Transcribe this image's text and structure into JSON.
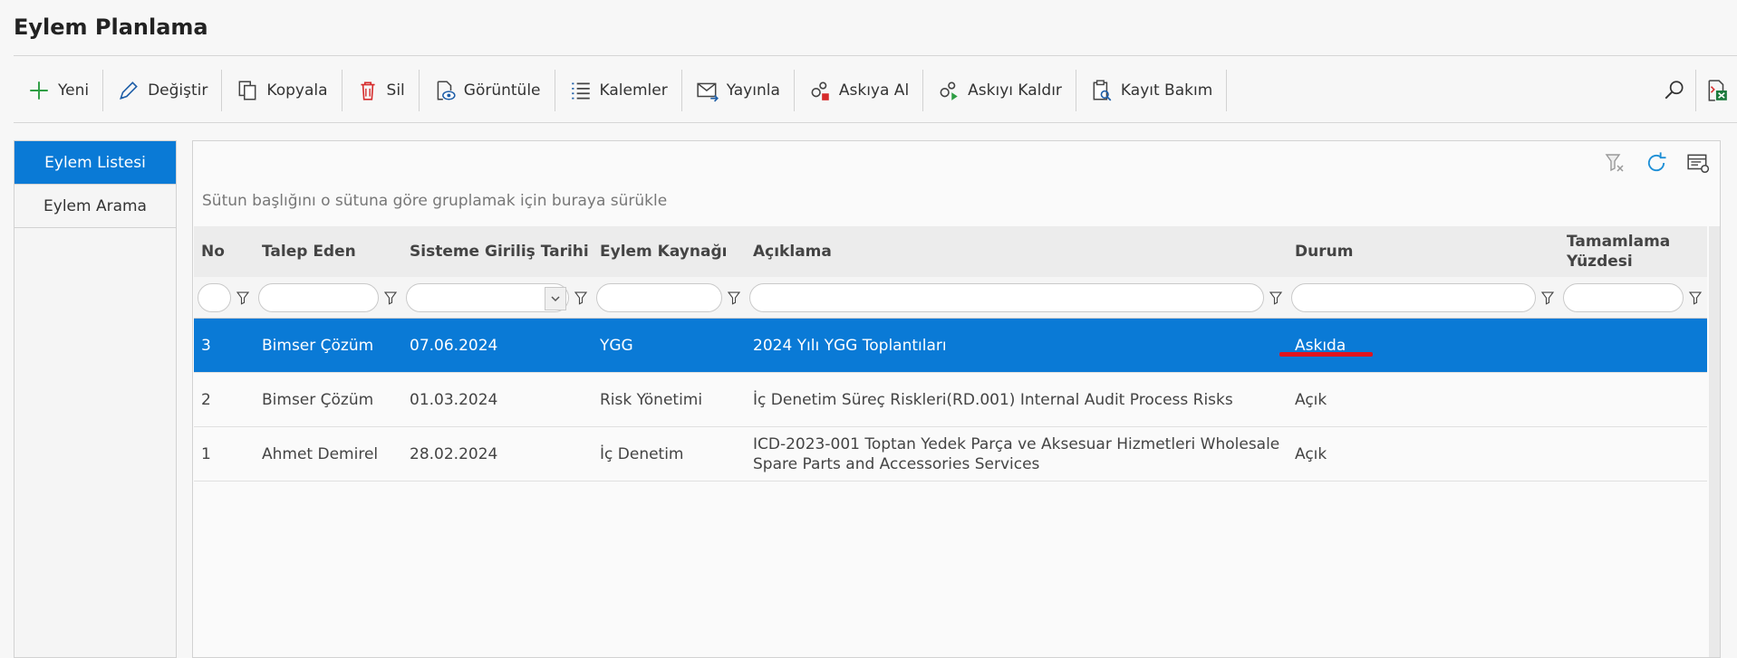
{
  "page": {
    "title": "Eylem Planlama"
  },
  "toolbar": {
    "items": [
      {
        "label": "Yeni",
        "icon": "plus-icon"
      },
      {
        "label": "Değiştir",
        "icon": "pencil-icon"
      },
      {
        "label": "Kopyala",
        "icon": "copy-icon"
      },
      {
        "label": "Sil",
        "icon": "trash-icon"
      },
      {
        "label": "Görüntüle",
        "icon": "eye-document-icon"
      },
      {
        "label": "Kalemler",
        "icon": "list-icon"
      },
      {
        "label": "Yayınla",
        "icon": "mail-send-icon"
      },
      {
        "label": "Askıya Al",
        "icon": "gears-stop-icon"
      },
      {
        "label": "Askıyı Kaldır",
        "icon": "gears-play-icon"
      },
      {
        "label": "Kayıt Bakım",
        "icon": "clipboard-search-icon"
      }
    ],
    "right_icons": [
      "search-icon",
      "excel-export-icon"
    ]
  },
  "sidebar": {
    "items": [
      {
        "label": "Eylem Listesi",
        "active": true
      },
      {
        "label": "Eylem Arama",
        "active": false
      }
    ]
  },
  "grid": {
    "group_hint": "Sütun başlığını o sütuna göre gruplamak için buraya sürükle",
    "columns": {
      "no": "No",
      "talep": "Talep Eden",
      "tarih": "Sisteme Giriliş Tarihi",
      "kaynak": "Eylem Kaynağı",
      "aciklama": "Açıklama",
      "durum": "Durum",
      "yuzde": "Tamamlama Yüzdesi"
    },
    "rows": [
      {
        "no": "3",
        "talep": "Bimser Çözüm",
        "tarih": "07.06.2024",
        "kaynak": "YGG",
        "aciklama": "2024 Yılı YGG Toplantıları",
        "durum": "Askıda",
        "yuzde": ""
      },
      {
        "no": "2",
        "talep": "Bimser Çözüm",
        "tarih": "01.03.2024",
        "kaynak": "Risk Yönetimi",
        "aciklama": "İç Denetim Süreç Riskleri(RD.001) Internal Audit Process Risks",
        "durum": "Açık",
        "yuzde": ""
      },
      {
        "no": "1",
        "talep": "Ahmet Demirel",
        "tarih": "28.02.2024",
        "kaynak": "İç Denetim",
        "aciklama": "ICD-2023-001 Toptan Yedek Parça ve Aksesuar Hizmetleri Wholesale Spare Parts and Accessories Services",
        "durum": "Açık",
        "yuzde": ""
      }
    ],
    "selected_row": 0
  },
  "colors": {
    "accent": "#0a7ad6",
    "highlight_underline": "#e0141e"
  }
}
